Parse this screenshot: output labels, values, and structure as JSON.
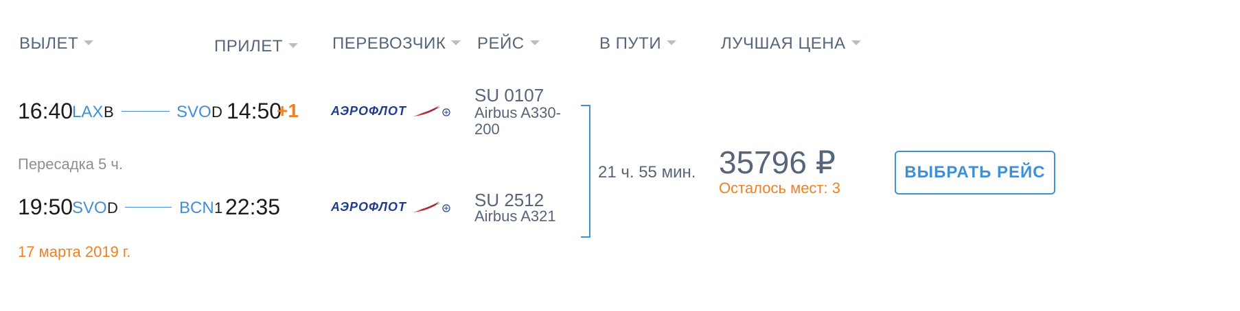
{
  "headers": {
    "depart": "ВЫЛЕТ",
    "arrive": "ПРИЛЕТ",
    "carrier": "ПЕРЕВОЗЧИК",
    "flight": "РЕЙС",
    "duration": "В ПУТИ",
    "price": "ЛУЧШАЯ ЦЕНА"
  },
  "segments": [
    {
      "dep_time": "16:40",
      "dep_code": "LAX",
      "dep_terminal": "B",
      "arr_code": "SVO",
      "arr_terminal": "D",
      "arr_time": "14:50",
      "day_offset": "+1",
      "carrier_logo": "АЭРОФЛОТ",
      "flight_no": "SU 0107",
      "aircraft_line1": "Airbus A330-",
      "aircraft_line2": "200"
    },
    {
      "dep_time": "19:50",
      "dep_code": "SVO",
      "dep_terminal": "D",
      "arr_code": "BCN",
      "arr_terminal": "1",
      "arr_time": "22:35",
      "carrier_logo": "АЭРОФЛОТ",
      "flight_no": "SU 2512",
      "aircraft_line1": "Airbus A321"
    }
  ],
  "layover": "Пересадка 5 ч.",
  "date": "17 марта 2019 г.",
  "total_duration": "21 ч. 55 мин.",
  "price": "35796 ₽",
  "seats_left": "Осталось мест: 3",
  "select_button": "ВЫБРАТЬ РЕЙС",
  "colors": {
    "accent": "#3f8fd6",
    "orange": "#f08020",
    "muted": "#56657a"
  }
}
